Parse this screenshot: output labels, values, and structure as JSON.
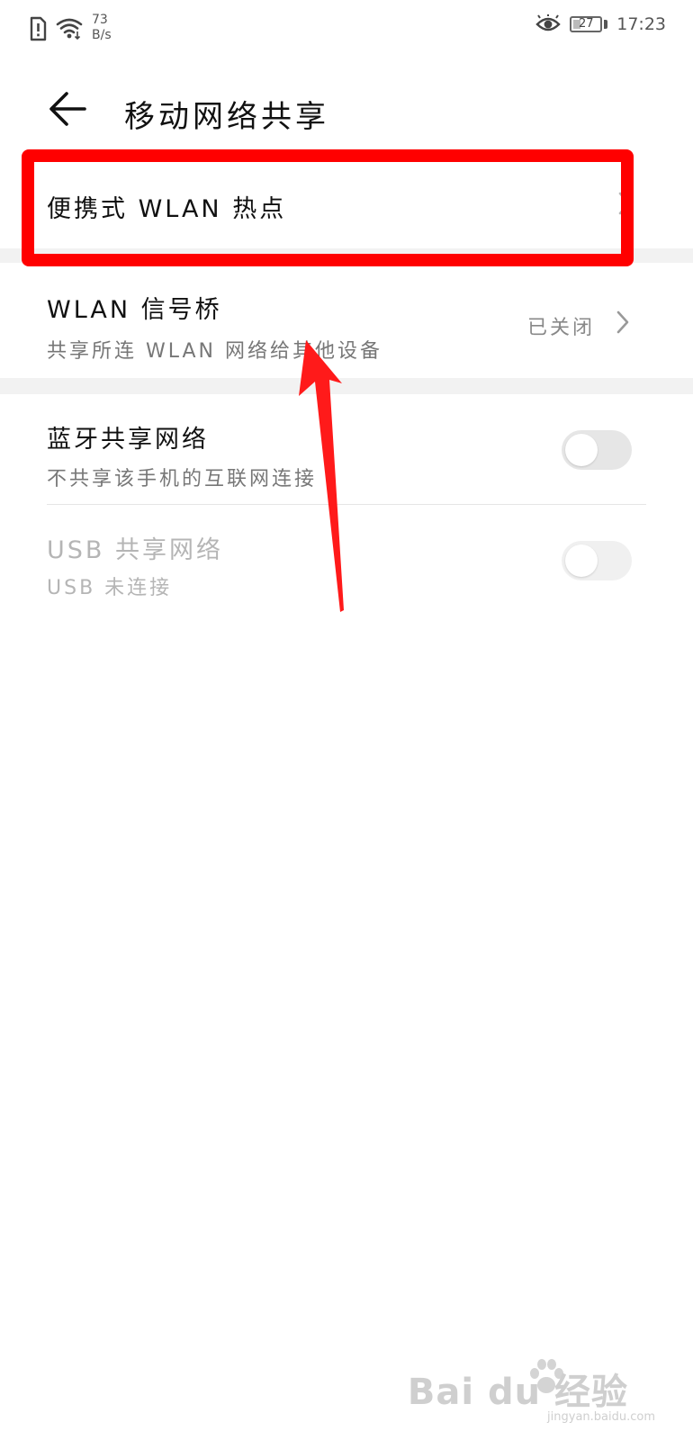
{
  "status_bar": {
    "net_speed_value": "73",
    "net_speed_unit": "B/s",
    "battery_level": "27",
    "time": "17:23",
    "icons": [
      "sim-alert-icon",
      "wifi-icon",
      "eye-icon",
      "battery-icon"
    ]
  },
  "header": {
    "title": "移动网络共享",
    "back_icon": "back-arrow-icon"
  },
  "items": [
    {
      "title": "便携式 WLAN 热点"
    },
    {
      "title": "WLAN 信号桥",
      "subtitle": "共享所连 WLAN 网络给其他设备",
      "value": "已关闭"
    },
    {
      "title": "蓝牙共享网络",
      "subtitle": "不共享该手机的互联网连接",
      "toggle_on": false
    },
    {
      "title": "USB 共享网络",
      "subtitle": "USB 未连接",
      "toggle_on": false,
      "disabled": true
    }
  ],
  "annotation": {
    "highlight_color": "#ff0000",
    "arrow_color": "#ff1a1a"
  },
  "watermark": {
    "logo": "Bai du 经验",
    "url": "jingyan.baidu.com"
  }
}
